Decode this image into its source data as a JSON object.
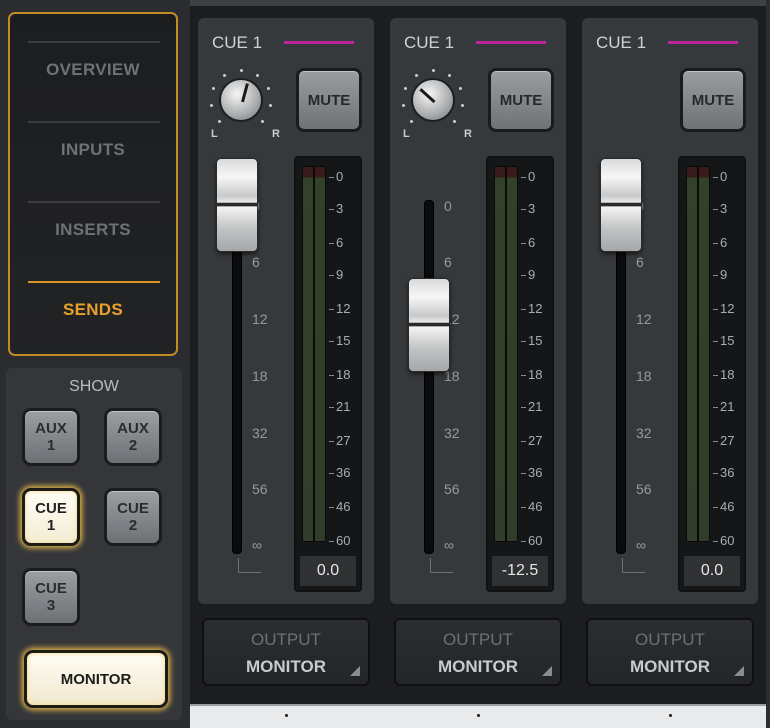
{
  "nav": {
    "items": [
      {
        "label": "OVERVIEW",
        "active": false
      },
      {
        "label": "INPUTS",
        "active": false
      },
      {
        "label": "INSERTS",
        "active": false
      },
      {
        "label": "SENDS",
        "active": true
      }
    ],
    "accent_color": "#e8a12a"
  },
  "show": {
    "title": "SHOW",
    "buttons": [
      {
        "label": "AUX\n1",
        "lit": false
      },
      {
        "label": "AUX\n2",
        "lit": false
      },
      {
        "label": "CUE\n1",
        "lit": true
      },
      {
        "label": "CUE\n2",
        "lit": false
      },
      {
        "label": "CUE\n3",
        "lit": false
      }
    ],
    "monitor_label": "MONITOR"
  },
  "fader_scale": [
    "0",
    "6",
    "12",
    "18",
    "32",
    "56",
    "∞"
  ],
  "meter_scale": [
    "0",
    "3",
    "6",
    "9",
    "12",
    "15",
    "18",
    "21",
    "27",
    "36",
    "46",
    "60"
  ],
  "channels": [
    {
      "cue_label": "CUE 1",
      "cue_color": "#c0229c",
      "pan_left": "L",
      "pan_right": "R",
      "pan_visible": true,
      "pan_angle_deg": 15,
      "mute_label": "MUTE",
      "fader_db": "0.0",
      "meter_readout": "0.0",
      "output_label": "OUTPUT",
      "output_value": "MONITOR"
    },
    {
      "cue_label": "CUE 1",
      "cue_color": "#c0229c",
      "pan_left": "L",
      "pan_right": "R",
      "pan_visible": true,
      "pan_angle_deg": -48,
      "mute_label": "MUTE",
      "fader_db": "-12.5",
      "meter_readout": "-12.5",
      "output_label": "OUTPUT",
      "output_value": "MONITOR"
    },
    {
      "cue_label": "CUE 1",
      "cue_color": "#c0229c",
      "pan_left": "",
      "pan_right": "",
      "pan_visible": false,
      "pan_angle_deg": 0,
      "mute_label": "MUTE",
      "fader_db": "0.0",
      "meter_readout": "0.0",
      "output_label": "OUTPUT",
      "output_value": "MONITOR"
    }
  ]
}
